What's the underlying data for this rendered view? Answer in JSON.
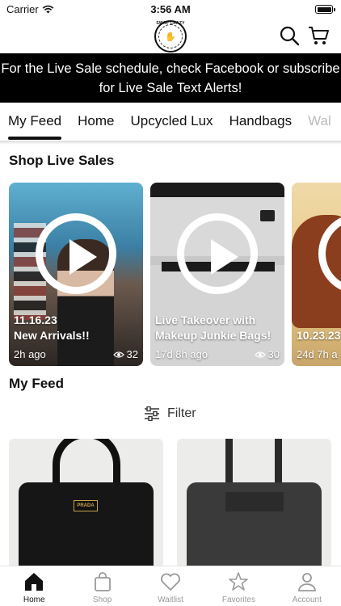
{
  "status_bar": {
    "carrier": "Carrier",
    "time": "3:56 AM"
  },
  "header": {
    "logo_text": "SWAP CRAZY HANDBAG LADY"
  },
  "banner": {
    "text": "For the Live Sale schedule, check Facebook or subscribe for Live Sale Text Alerts!"
  },
  "tabs": [
    {
      "label": "My Feed",
      "active": true
    },
    {
      "label": "Home"
    },
    {
      "label": "Upcycled Lux"
    },
    {
      "label": "Handbags"
    },
    {
      "label": "Wal",
      "faded": true
    }
  ],
  "sections": {
    "live_title": "Shop Live Sales",
    "feed_title": "My Feed"
  },
  "live_sales": [
    {
      "title_line1": "11.16.23",
      "title_line2": "New Arrivals!!",
      "age": "2h ago",
      "views": "32"
    },
    {
      "title_line1": "Live Takeover with",
      "title_line2": "Makeup Junkie Bags!",
      "age": "17d 8h ago",
      "views": "30"
    },
    {
      "title_line1": "",
      "title_line2": "10.23.23",
      "age": "24d 7h a",
      "views": ""
    }
  ],
  "filter": {
    "label": "Filter"
  },
  "products": [
    {
      "plaque": "PRADA"
    },
    {}
  ],
  "tabbar": [
    {
      "label": "Home",
      "icon": "home-icon",
      "active": true
    },
    {
      "label": "Shop",
      "icon": "bag-icon"
    },
    {
      "label": "Waitlist",
      "icon": "heart-icon"
    },
    {
      "label": "Favorites",
      "icon": "star-icon"
    },
    {
      "label": "Account",
      "icon": "person-icon"
    }
  ]
}
